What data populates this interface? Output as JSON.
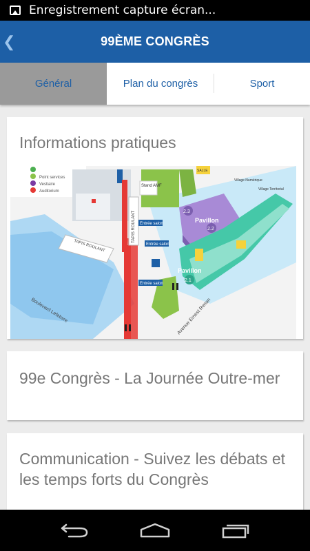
{
  "status_bar": {
    "notification": "Enregistrement capture écran..."
  },
  "action_bar": {
    "title": "99ÈME CONGRÈS",
    "back_glyph": "❮"
  },
  "tabs": [
    {
      "label": "Général",
      "active": true
    },
    {
      "label": "Plan du congrès",
      "active": false
    },
    {
      "label": "Sport",
      "active": false
    }
  ],
  "cards": [
    {
      "title": "Informations pratiques"
    },
    {
      "title": "99e Congrès - La Journée Outre-mer"
    },
    {
      "title": "Communication - Suivez les débats et les temps forts du Congrès"
    }
  ],
  "map": {
    "legend": [
      "Point services",
      "Vestiaire",
      "Auditorium"
    ],
    "labels": {
      "stand": "Stand AMF",
      "tapis1": "TAPIS ROULANT",
      "tapis2": "TAPIS ROULANT",
      "entree1": "Entrée salon",
      "entree2": "Entrée salon",
      "entree3": "Entrée salon",
      "pavillon1": "Pavillon",
      "pavillon1_num": "2.2",
      "pavillon2": "Pavillon",
      "pavillon2_num": "2.1",
      "salle_num": "2.3",
      "village1": "Village Numérique",
      "village2": "Village Territorial",
      "boulevard": "Boulevard Lefebvre",
      "avenue": "Avenue Ernest Renan",
      "salle": "SALLE"
    }
  },
  "icons": {
    "status": "image-icon",
    "back": "chevron-left-icon",
    "nav": [
      "back-arrow-icon",
      "home-icon",
      "recent-apps-icon"
    ]
  },
  "colors": {
    "primary": "#1d5fa6",
    "active_tab_bg": "#9a9a9a",
    "map_water": "#9fd0f2",
    "pavilion_purple": "#a88ad6",
    "pavilion_teal": "#45c8a8"
  }
}
